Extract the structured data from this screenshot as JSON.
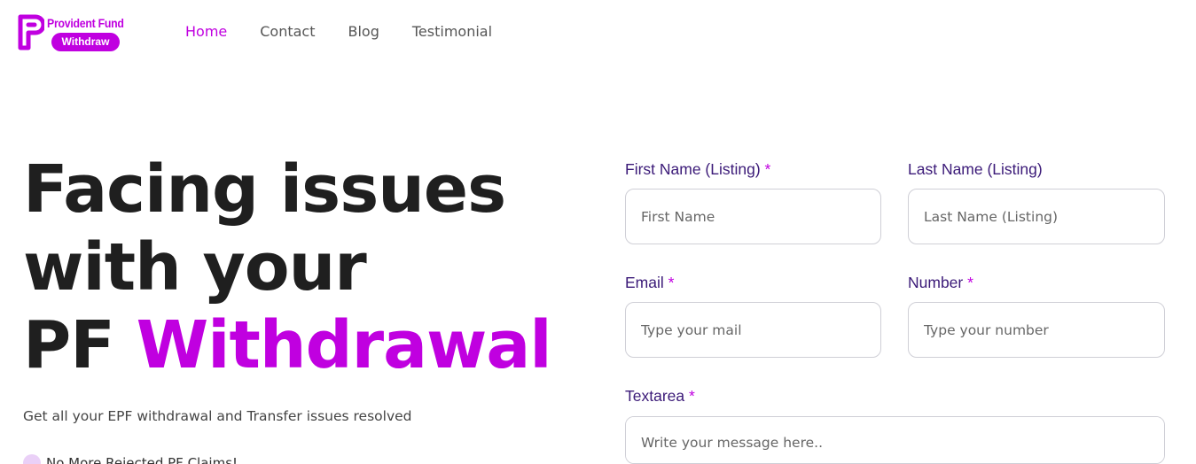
{
  "logo": {
    "top_text": "Provident Fund",
    "pill_text": "Withdraw"
  },
  "nav": {
    "items": [
      {
        "label": "Home",
        "active": true
      },
      {
        "label": "Contact",
        "active": false
      },
      {
        "label": "Blog",
        "active": false
      },
      {
        "label": "Testimonial",
        "active": false
      }
    ]
  },
  "hero": {
    "line1": "Facing issues",
    "line2": "with your",
    "line3_prefix": "PF",
    "line3_accent": "Withdrawal",
    "subtitle": "Get all your EPF withdrawal and Transfer issues resolved",
    "bullet": "No More Rejected PF Claims!"
  },
  "form": {
    "first_name": {
      "label": "First Name (Listing)",
      "required": "*",
      "placeholder": "First Name"
    },
    "last_name": {
      "label": "Last Name (Listing)",
      "required": "",
      "placeholder": "Last Name (Listing)"
    },
    "email": {
      "label": "Email",
      "required": "*",
      "placeholder": "Type your mail"
    },
    "number": {
      "label": "Number",
      "required": "*",
      "placeholder": "Type your number"
    },
    "textarea": {
      "label": "Textarea",
      "required": "*",
      "placeholder": "Write your message here.."
    }
  },
  "colors": {
    "accent": "#c000e0",
    "label": "#3b1a78",
    "heading": "#1f1f1f"
  }
}
